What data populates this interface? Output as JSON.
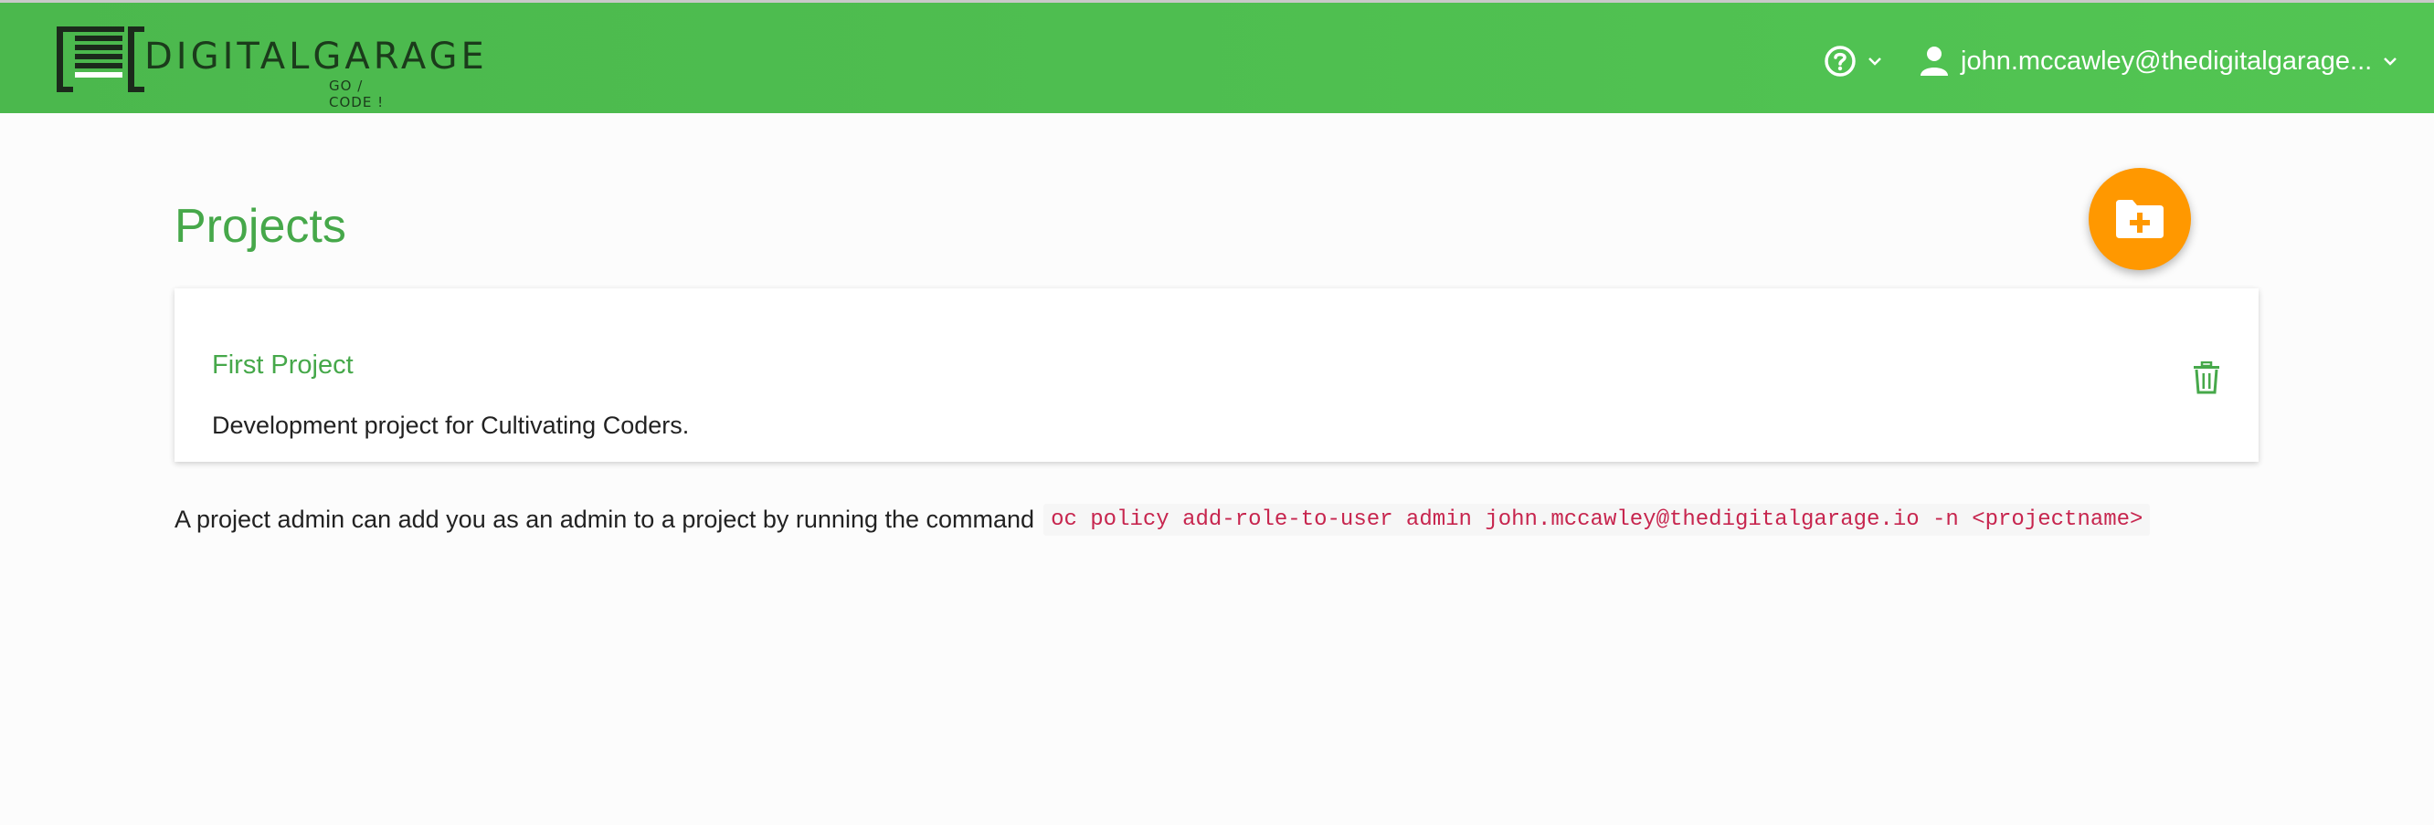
{
  "header": {
    "logo_text": "DIGITALGARAGE",
    "logo_subtext": "GO / CODE !",
    "help_icon": "question-circle-icon",
    "user_icon": "person-icon",
    "user_email": "john.mccawley@thedigitalgarage...",
    "brand_color": "#4bb84d"
  },
  "main": {
    "title": "Projects",
    "add_project_icon": "folder-plus-icon",
    "fab_color": "#ff9800",
    "projects": [
      {
        "name": "First Project",
        "description": "Development project for Cultivating Coders.",
        "delete_icon": "trash-icon"
      }
    ],
    "help_text": "A project admin can add you as an admin to a project by running the command",
    "command": "oc policy add-role-to-user admin john.mccawley@thedigitalgarage.io -n <projectname>"
  }
}
